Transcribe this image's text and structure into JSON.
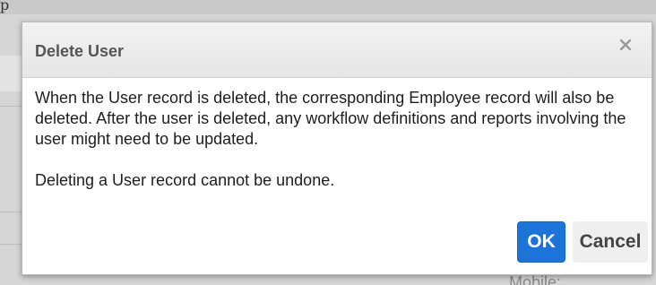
{
  "background": {
    "partial_label": "Mobile:"
  },
  "dialog": {
    "title": "Delete User",
    "body_paragraphs": [
      "When the User record is deleted, the corresponding Employee record will also be deleted. After the user is deleted, any workflow definitions and reports involving the user might need to be updated.",
      "Deleting a User record cannot be undone."
    ],
    "ok_label": "OK",
    "cancel_label": "Cancel",
    "close_icon": "close-icon"
  },
  "colors": {
    "primary_button": "#1c74d8",
    "secondary_button": "#efefef",
    "header_background": "#eaeaea"
  }
}
